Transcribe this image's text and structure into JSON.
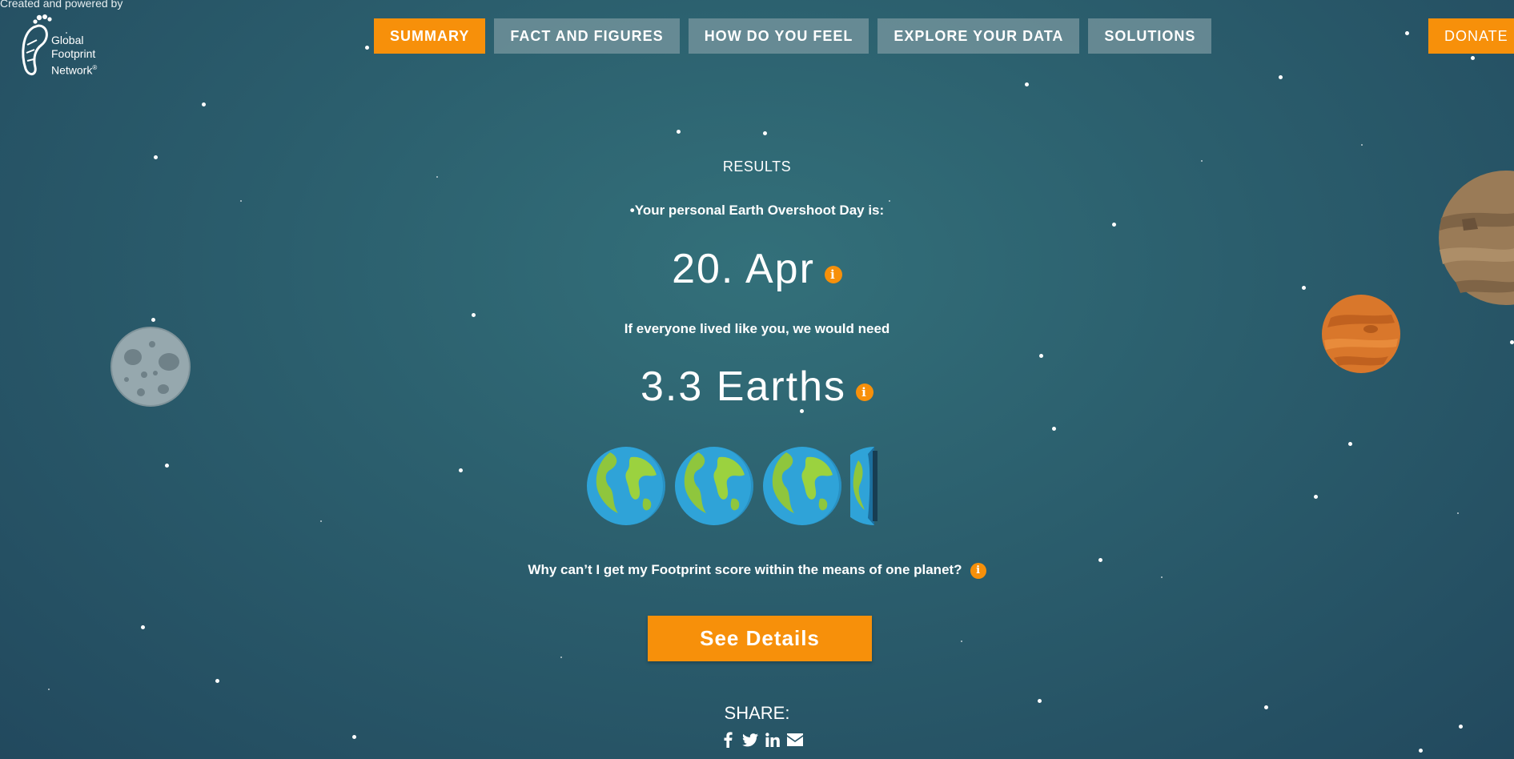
{
  "header": {
    "credit_text": "Created and powered by",
    "logo": {
      "icon": "footprint-logo-icon",
      "line1": "Global",
      "line2": "Footprint",
      "line3": "Network",
      "mark": "®"
    }
  },
  "nav": {
    "items": [
      {
        "label": "SUMMARY",
        "active": true
      },
      {
        "label": "FACT AND FIGURES",
        "active": false
      },
      {
        "label": "HOW DO YOU FEEL",
        "active": false
      },
      {
        "label": "EXPLORE YOUR DATA",
        "active": false
      },
      {
        "label": "SOLUTIONS",
        "active": false
      }
    ],
    "donate_label": "DONATE"
  },
  "results": {
    "title": "RESULTS",
    "overshoot_label": "•Your personal Earth Overshoot Day is:",
    "overshoot_day": "20. Apr",
    "need_label": "If everyone lived like you, we would need",
    "earths_value": "3.3 Earths",
    "earths_count": 3.3,
    "info_glyph": "i",
    "why_question": "Why can’t I get my Footprint score within the means of one planet?",
    "details_button": "See Details"
  },
  "share": {
    "label": "SHARE:",
    "icons": [
      "facebook-icon",
      "twitter-icon",
      "linkedin-icon",
      "email-icon"
    ]
  },
  "colors": {
    "accent": "#f7900a",
    "nav_inactive": "#7f9ca5",
    "background": "#2b5e6d"
  }
}
